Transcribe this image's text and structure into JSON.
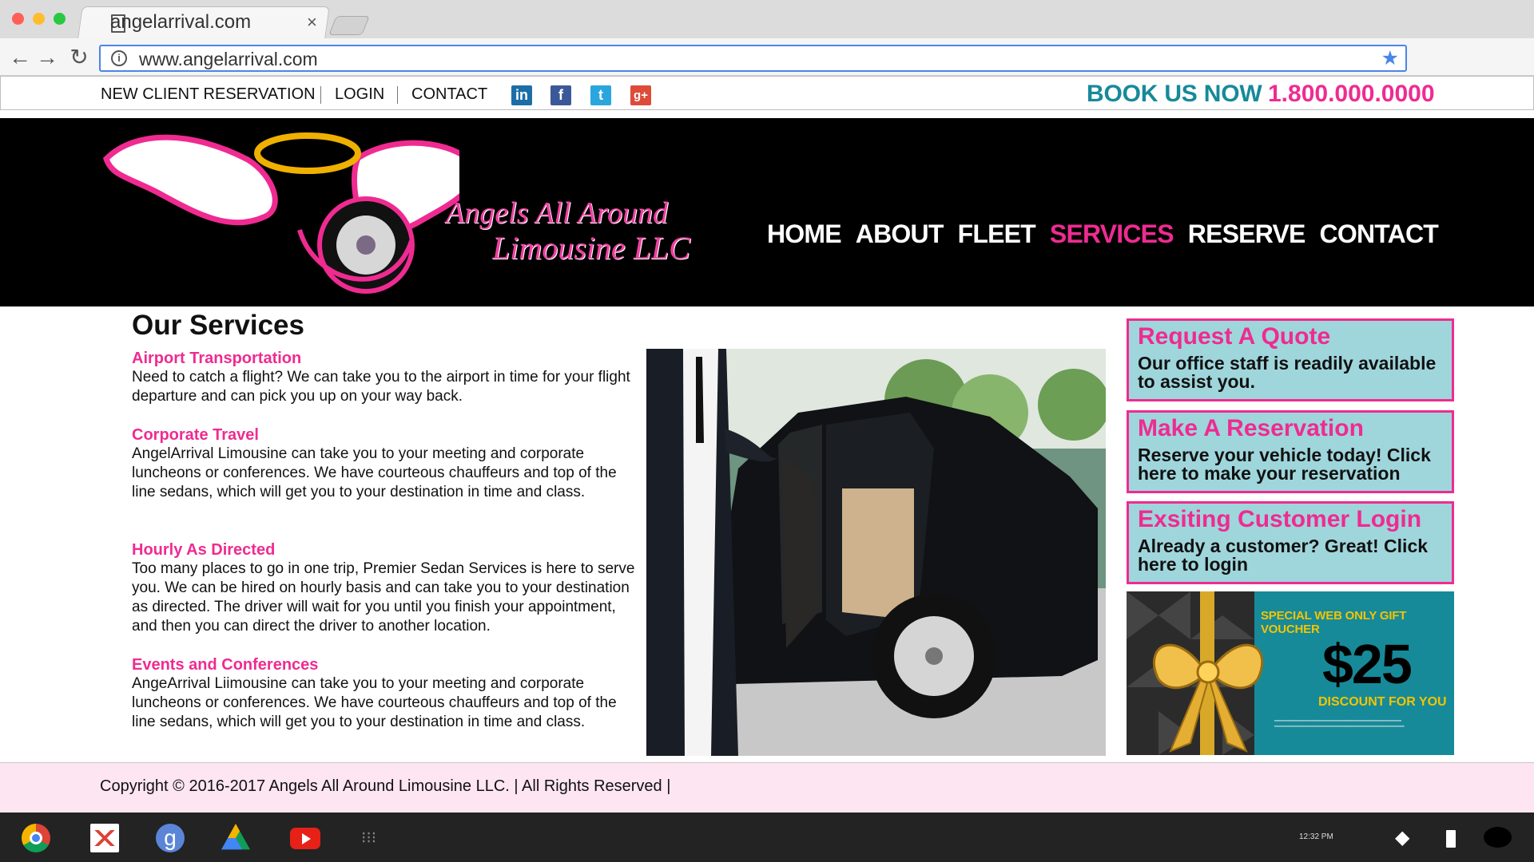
{
  "browser": {
    "tab_title": "angelarrival.com",
    "url": "www.angelarrival.com",
    "close": "×"
  },
  "top_links": {
    "new_client_reservation": "NEW CLIENT RESERVATION",
    "login": "LOGIN",
    "contact": "CONTACT"
  },
  "social": [
    "in",
    "f",
    "t",
    "g+"
  ],
  "booking": {
    "book_us_now": "BOOK US NOW",
    "phone": "1.800.000.0000"
  },
  "logo": {
    "line1": "Angels All Around",
    "line2": "Limousine LLC"
  },
  "nav": [
    "HOME",
    "ABOUT",
    "FLEET",
    "SERVICES",
    "RESERVE",
    "CONTACT"
  ],
  "active_nav": "SERVICES",
  "content": {
    "title": "Our Services",
    "services": [
      {
        "heading": "Airport Transportation",
        "text": "Need to catch a flight? We can take you to the airport in time for your flight departure and can pick you up on your way back."
      },
      {
        "heading": "Corporate Travel",
        "text": "AngelArrival Limousine can take you to your meeting and corporate luncheons or conferences. We have courteous chauffeurs and top of the line sedans, which will get you to your destination in time and class."
      },
      {
        "heading": "Hourly As Directed",
        "text": "Too many places to go in one trip, Premier Sedan Services is here to serve you. We can be hired on hourly basis and can take you to your destination as directed. The driver will wait for you until you finish your appointment, and then you can direct the driver to another location."
      },
      {
        "heading": "Events and Conferences",
        "text": "AngeArrival Liimousine can take you to your meeting and corporate luncheons or conferences. We have courteous chauffeurs and top of the line sedans, which will get you to your destination in time and class."
      }
    ]
  },
  "sidebar": {
    "quote": {
      "title": "Request A Quote",
      "text": "Our office staff is readily available to assist you."
    },
    "reservation": {
      "title": "Make A Reservation",
      "text": "Reserve your vehicle today! Click here to make your reservation"
    },
    "login": {
      "title": "Exsiting Customer Login",
      "text": "Already a customer? Great! Click here to login"
    }
  },
  "voucher": {
    "title": "SPECIAL WEB ONLY GIFT VOUCHER",
    "amount": "$25",
    "discount": "DISCOUNT FOR YOU"
  },
  "footer": {
    "text": "Copyright © 2016-2017 Angels All Around Limousine LLC. | All Rights Reserved |"
  },
  "shelf": {
    "time": "12:32 PM"
  },
  "colors": {
    "accent_pink": "#ef2b91",
    "teal": "#168a99",
    "header_bg": "#000000"
  }
}
